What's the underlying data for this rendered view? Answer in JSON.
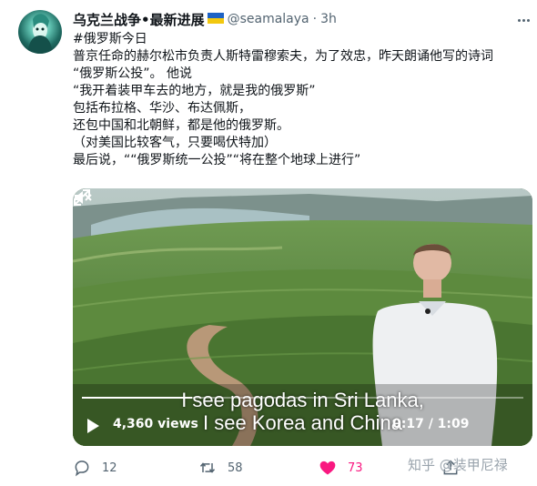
{
  "tweet": {
    "display_name": "乌克兰战争•最新进展",
    "handle": "@seamalaya",
    "separator": "·",
    "time": "3h",
    "text_lines": [
      "#俄罗斯今日",
      "普京任命的赫尔松市负责人斯特雷穆索夫，为了效忠，昨天朗诵他写的诗词",
      "“俄罗斯公投”。  他说",
      "“我开着装甲车去的地方，就是我的俄罗斯”",
      "包括布拉格、华沙、布达佩斯，",
      "还包中国和北朝鲜，都是他的俄罗斯。",
      "（对美国比较客气，只要喝伏特加）",
      "最后说，““俄罗斯统一公投”“将在整个地球上进行”"
    ]
  },
  "video": {
    "subtitle_line1": "I see pagodas in Sri Lanka,",
    "subtitle_line2": "I see Korea and China",
    "views": "4,360 views",
    "time_readout": "0:17 / 1:09",
    "progress_fraction": 0.25
  },
  "actions": {
    "reply_count": "12",
    "retweet_count": "58",
    "like_count": "73"
  },
  "watermark": "知乎 @装甲尼禄",
  "icons": [
    "more-icon",
    "flag-icon",
    "play-icon",
    "mute-icon",
    "fullscreen-icon",
    "reply-icon",
    "retweet-icon",
    "like-icon",
    "share-icon"
  ],
  "colors": {
    "like": "#f91880",
    "secondary_text": "#536471",
    "flag_blue": "#1d62c4",
    "flag_yellow": "#f2c80f"
  }
}
